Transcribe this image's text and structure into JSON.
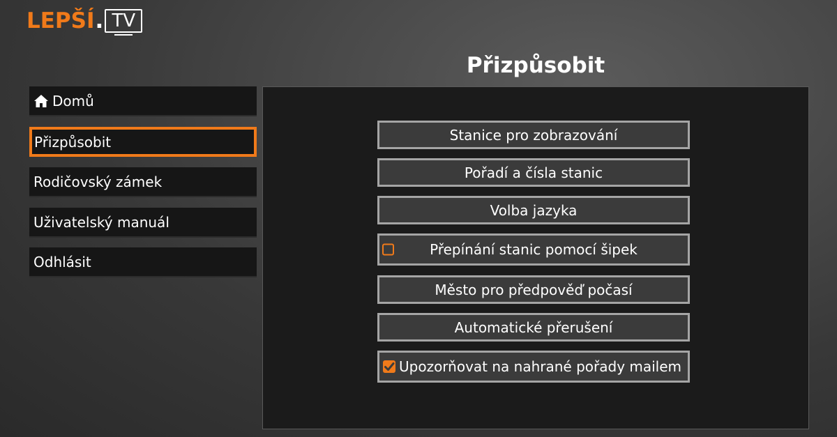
{
  "logo": {
    "brand_text": "LEPŠÍ",
    "dot": ".",
    "tv_text": "TV"
  },
  "page": {
    "title": "Přizpůsobit"
  },
  "sidebar": {
    "items": [
      {
        "label": "Domů",
        "icon": "home-icon",
        "active": false
      },
      {
        "label": "Přizpůsobit",
        "active": true
      },
      {
        "label": "Rodičovský zámek",
        "active": false
      },
      {
        "label": "Uživatelský manuál",
        "active": false
      },
      {
        "label": "Odhlásit",
        "active": false
      }
    ]
  },
  "options": [
    {
      "label": "Stanice pro zobrazování"
    },
    {
      "label": "Pořadí a čísla stanic"
    },
    {
      "label": "Volba jazyka"
    },
    {
      "label": "Přepínání stanic pomocí šipek",
      "checkbox": true,
      "checked": false
    },
    {
      "label": "Město pro předpověď počasí"
    },
    {
      "label": "Automatické přerušení"
    },
    {
      "label": "Upozorňovat na nahrané pořady mailem",
      "checkbox": true,
      "checked": true
    }
  ],
  "colors": {
    "accent": "#f07a1a",
    "panel_bg": "#1b1b1b",
    "button_bg": "#3b3b3b",
    "button_border": "#a5a5a5"
  }
}
